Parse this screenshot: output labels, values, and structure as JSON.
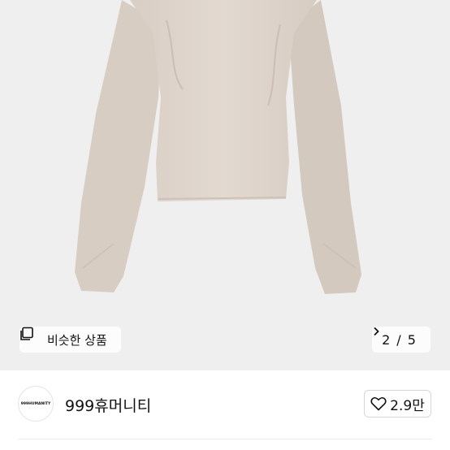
{
  "product_image": {
    "alt": ""
  },
  "similar_button": {
    "label": "비슷한 상품",
    "icon": "similar-items-icon"
  },
  "pager": {
    "current": "2",
    "separator": "/",
    "total": "5",
    "icon": "chevron-right-icon"
  },
  "seller": {
    "avatar_text": "999HUMANITY",
    "name": "999휴머니티"
  },
  "like": {
    "count": "2.9만",
    "icon": "heart-outline-icon"
  },
  "colors": {
    "hero_bg": "#efefef",
    "garment": "#ddd3ca",
    "text": "#111111"
  }
}
